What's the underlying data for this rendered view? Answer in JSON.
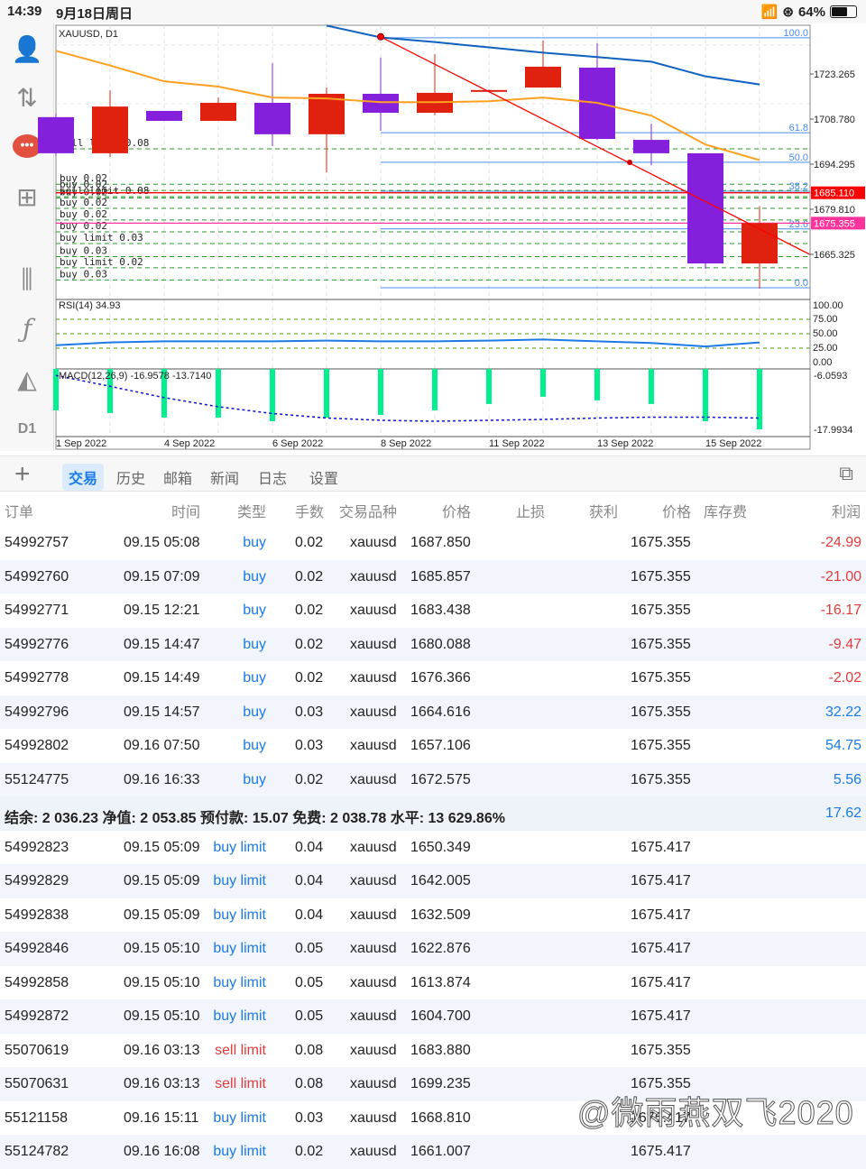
{
  "status": {
    "time": "14:39",
    "date": "9月18日周日",
    "battery": "64%"
  },
  "sidebar": {
    "timeframe": "D1"
  },
  "chart_data": {
    "type": "candlestick",
    "title": "XAUUSD, D1",
    "x_labels": [
      "1 Sep 2022",
      "4 Sep 2022",
      "6 Sep 2022",
      "8 Sep 2022",
      "11 Sep 2022",
      "13 Sep 2022",
      "15 Sep 2022"
    ],
    "x_label_index": [
      0,
      2,
      4,
      6,
      8,
      10,
      12
    ],
    "price_ticks": [
      "1723.265",
      "1708.780",
      "1694.295",
      "1679.810",
      "1665.325"
    ],
    "price_tick_values": [
      1723.265,
      1708.78,
      1694.295,
      1679.81,
      1665.325
    ],
    "price_range": [
      1651.0,
      1739.0
    ],
    "ask": {
      "label": "1685.110",
      "value": 1685.11,
      "color": "#ff0000"
    },
    "bid": {
      "label": "1675.355",
      "value": 1675.355,
      "color": "#ff3399"
    },
    "candles": [
      {
        "o": 1709.4,
        "h": 1710.5,
        "l": 1697,
        "c": 1697.8
      },
      {
        "o": 1697.8,
        "h": 1718.0,
        "l": 1696.6,
        "c": 1712.8
      },
      {
        "o": 1711.4,
        "h": 1711.4,
        "l": 1708.2,
        "c": 1708.2
      },
      {
        "o": 1708.2,
        "h": 1715.7,
        "l": 1708.2,
        "c": 1714.0
      },
      {
        "o": 1714.0,
        "h": 1726.7,
        "l": 1700.1,
        "c": 1703.9
      },
      {
        "o": 1703.9,
        "h": 1718.9,
        "l": 1691.7,
        "c": 1716.9
      },
      {
        "o": 1716.9,
        "h": 1728.5,
        "l": 1705.0,
        "c": 1710.8
      },
      {
        "o": 1710.8,
        "h": 1729.6,
        "l": 1710.0,
        "c": 1717.2
      },
      {
        "o": 1718.0,
        "h": 1718.3,
        "l": 1717.7,
        "c": 1718.1
      },
      {
        "o": 1718.9,
        "h": 1734.0,
        "l": 1718.9,
        "c": 1725.6
      },
      {
        "o": 1725.3,
        "h": 1733.1,
        "l": 1702.0,
        "c": 1702.4
      },
      {
        "o": 1702.1,
        "h": 1707.3,
        "l": 1694.0,
        "c": 1697.8
      },
      {
        "o": 1697.8,
        "h": 1697.8,
        "l": 1660.7,
        "c": 1662.4
      },
      {
        "o": 1662.4,
        "h": 1680.7,
        "l": 1654.3,
        "c": 1675.355
      }
    ],
    "colors": {
      "up": "#e0210f",
      "down": "#8420dc",
      "ma_fast": "#ffa020",
      "ma_slow": "#0f62c0",
      "trend": "#ff0000",
      "fib": "#4a8cf0",
      "orders": "#2a9a2a"
    },
    "ma_fast": [
      1730.7,
      1726,
      1720.9,
      1719.2,
      1715.7,
      1715.4,
      1714.2,
      1714.2,
      1714.5,
      1715.7,
      1714.0,
      1709.9,
      1700.6,
      1695.6
    ],
    "ma_slow": [
      null,
      null,
      null,
      null,
      null,
      1738.8,
      1735.0,
      1733.5,
      1731.8,
      1730.1,
      1728.7,
      1727.2,
      1722.5,
      1719.9
    ],
    "trendline": {
      "from_index": 6,
      "from": 1735.2,
      "to_index": 13.93,
      "to": 1665.3
    },
    "fib": {
      "from_index": 6,
      "levels": [
        {
          "label": "100.0",
          "value": 1734.9
        },
        {
          "label": "61.8",
          "value": 1704.4
        },
        {
          "label": "50.0",
          "value": 1694.9
        },
        {
          "label": "38.2",
          "value": 1685.6
        },
        {
          "label": "23.6",
          "value": 1673.5
        },
        {
          "label": "0.0",
          "value": 1654.6
        }
      ]
    },
    "order_lines": [
      {
        "label": "sell limit 0.08",
        "value": 1699.235
      },
      {
        "label": "buy 0.02",
        "value": 1687.85
      },
      {
        "label": "buy 0.02",
        "value": 1685.857
      },
      {
        "label": "sell limit 0.08",
        "value": 1683.88
      },
      {
        "label": "buy 0.02",
        "value": 1683.438
      },
      {
        "label": "buy 0.02",
        "value": 1680.088
      },
      {
        "label": "buy 0.02",
        "value": 1676.366
      },
      {
        "label": "buy 0.02",
        "value": 1672.575
      },
      {
        "label": "buy limit 0.03",
        "value": 1668.81
      },
      {
        "label": "buy 0.03",
        "value": 1664.616
      },
      {
        "label": "buy limit 0.02",
        "value": 1661.007
      },
      {
        "label": "buy 0.03",
        "value": 1657.106
      }
    ],
    "rsi": {
      "title": "RSI(14) 34.93",
      "ticks": [
        "100.00",
        "75.00",
        "50.00",
        "25.00",
        "0.00"
      ],
      "levels": [
        75,
        50,
        25
      ],
      "values": [
        30,
        35,
        37,
        37,
        37,
        38,
        37,
        37,
        38,
        40,
        37,
        34,
        28,
        35
      ],
      "color": "#1a7ae8"
    },
    "macd": {
      "title": "MACD(12,26,9) -16.9578 -13.7140",
      "ticks": [
        "-6.0593",
        "-17.9934"
      ],
      "range": [
        -4.87,
        -19.5
      ],
      "hist": [
        -13.8,
        -14.4,
        -15.4,
        -15.4,
        -16.2,
        -15.4,
        -14.8,
        -13.8,
        -12.4,
        -10.8,
        -11.6,
        -12.4,
        -16.2,
        -17.99
      ],
      "signal": [
        -6.1,
        -8.5,
        -11,
        -13,
        -14.5,
        -15.5,
        -16,
        -16.2,
        -16,
        -15.8,
        -15.5,
        -15.3,
        -15.3,
        -15.5
      ],
      "hist_color": "#00f090",
      "signal_color": "#1010d0"
    }
  },
  "toolbar": {
    "tabs": [
      "交易",
      "历史",
      "邮箱",
      "新闻",
      "日志",
      "设置"
    ]
  },
  "table": {
    "headers": [
      "订单",
      "时间",
      "类型",
      "手数",
      "交易品种",
      "价格",
      "止损",
      "获利",
      "价格",
      "库存费",
      "利润"
    ],
    "positions": [
      [
        "54992757",
        "09.15 05:08",
        "buy",
        "0.02",
        "xauusd",
        "1687.850",
        "1675.355",
        "-24.99"
      ],
      [
        "54992760",
        "09.15 07:09",
        "buy",
        "0.02",
        "xauusd",
        "1685.857",
        "1675.355",
        "-21.00"
      ],
      [
        "54992771",
        "09.15 12:21",
        "buy",
        "0.02",
        "xauusd",
        "1683.438",
        "1675.355",
        "-16.17"
      ],
      [
        "54992776",
        "09.15 14:47",
        "buy",
        "0.02",
        "xauusd",
        "1680.088",
        "1675.355",
        "-9.47"
      ],
      [
        "54992778",
        "09.15 14:49",
        "buy",
        "0.02",
        "xauusd",
        "1676.366",
        "1675.355",
        "-2.02"
      ],
      [
        "54992796",
        "09.15 14:57",
        "buy",
        "0.03",
        "xauusd",
        "1664.616",
        "1675.355",
        "32.22"
      ],
      [
        "54992802",
        "09.16 07:50",
        "buy",
        "0.03",
        "xauusd",
        "1657.106",
        "1675.355",
        "54.75"
      ],
      [
        "55124775",
        "09.16 16:33",
        "buy",
        "0.02",
        "xauusd",
        "1672.575",
        "1675.355",
        "5.56"
      ]
    ],
    "summary": {
      "text": "结余:  2 036.23 净值:  2 053.85 预付款:  15.07 免费:  2 038.78 水平:  13 629.86%",
      "profit": "17.62"
    },
    "orders": [
      [
        "54992823",
        "09.15 05:09",
        "buy limit",
        "0.04",
        "xauusd",
        "1650.349",
        "1675.417"
      ],
      [
        "54992829",
        "09.15 05:09",
        "buy limit",
        "0.04",
        "xauusd",
        "1642.005",
        "1675.417"
      ],
      [
        "54992838",
        "09.15 05:09",
        "buy limit",
        "0.04",
        "xauusd",
        "1632.509",
        "1675.417"
      ],
      [
        "54992846",
        "09.15 05:10",
        "buy limit",
        "0.05",
        "xauusd",
        "1622.876",
        "1675.417"
      ],
      [
        "54992858",
        "09.15 05:10",
        "buy limit",
        "0.05",
        "xauusd",
        "1613.874",
        "1675.417"
      ],
      [
        "54992872",
        "09.15 05:10",
        "buy limit",
        "0.05",
        "xauusd",
        "1604.700",
        "1675.417"
      ],
      [
        "55070619",
        "09.16 03:13",
        "sell limit",
        "0.08",
        "xauusd",
        "1683.880",
        "1675.355"
      ],
      [
        "55070631",
        "09.16 03:13",
        "sell limit",
        "0.08",
        "xauusd",
        "1699.235",
        "1675.355"
      ],
      [
        "55121158",
        "09.16 15:11",
        "buy limit",
        "0.03",
        "xauusd",
        "1668.810",
        "1675.417"
      ],
      [
        "55124782",
        "09.16 16:08",
        "buy limit",
        "0.02",
        "xauusd",
        "1661.007",
        "1675.417"
      ]
    ]
  },
  "watermark": "@微雨燕双飞2020"
}
